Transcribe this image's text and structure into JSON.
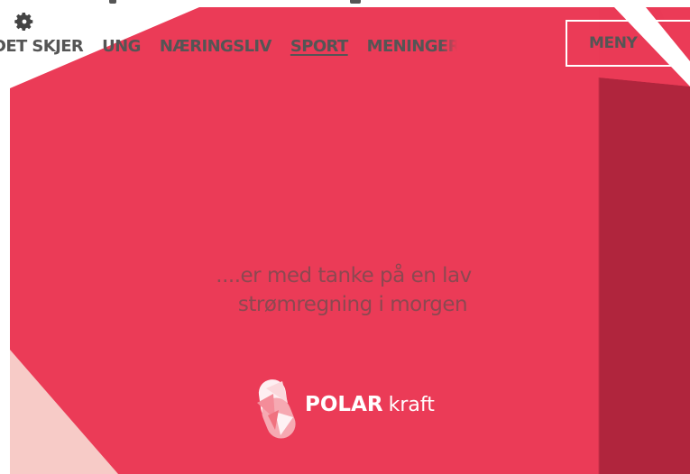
{
  "header": {
    "nav": [
      {
        "label": "DET SKJER",
        "active": false
      },
      {
        "label": "UNG",
        "active": false
      },
      {
        "label": "NÆRINGSLIV",
        "active": false
      },
      {
        "label": "SPORT",
        "active": true
      },
      {
        "label": "MENINGER",
        "active": false
      }
    ],
    "menu_label": "MENY",
    "settings_icon": "gear-icon"
  },
  "ad": {
    "tagline_line1": "....er med tanke på en lav",
    "tagline_line2": "strømregning i morgen",
    "brand_bold": "POLAR",
    "brand_light": "kraft",
    "logo_icon": "polarkraft-logo-icon"
  },
  "colors": {
    "ad_background": "#eb3b57",
    "ad_shade": "#b0253d",
    "ad_highlight": "#f7cbc7",
    "nav_text": "#555555",
    "tagline_text": "#8c4851",
    "brand_text": "#ffffff"
  }
}
